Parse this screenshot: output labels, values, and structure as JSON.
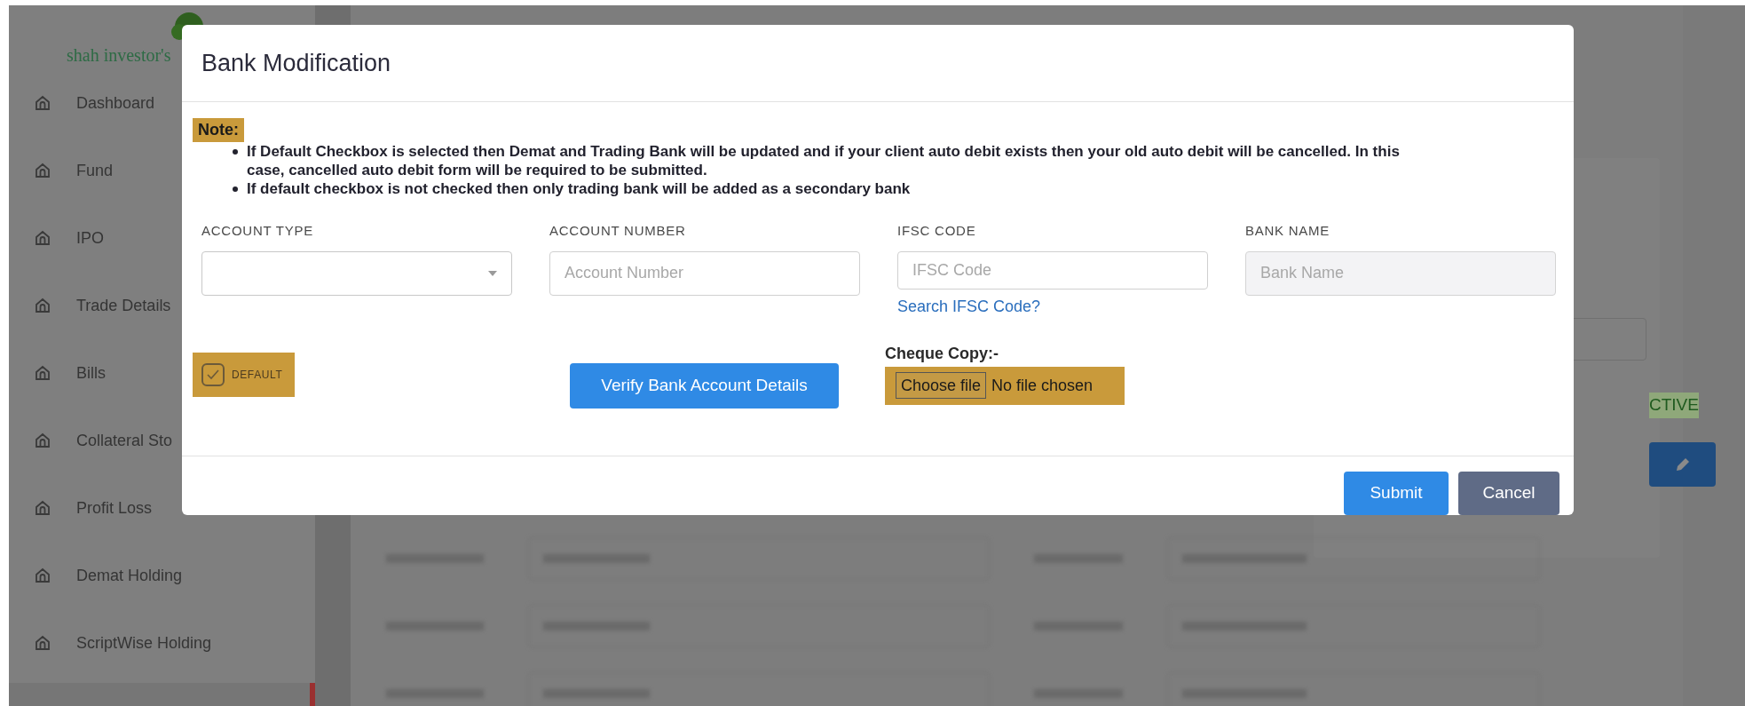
{
  "sidebar": {
    "logo_text": "shah investor's",
    "items": [
      {
        "label": "Dashboard"
      },
      {
        "label": "Fund"
      },
      {
        "label": "IPO"
      },
      {
        "label": "Trade Details"
      },
      {
        "label": "Bills"
      },
      {
        "label": "Collateral Sto"
      },
      {
        "label": "Profit Loss"
      },
      {
        "label": "Demat Holding"
      },
      {
        "label": "ScriptWise Holding"
      }
    ]
  },
  "background": {
    "status_text": "CTIVE"
  },
  "modal": {
    "title": "Bank Modification",
    "note": {
      "label": "Note:",
      "highlighted": true,
      "bullets": [
        "If Default Checkbox is selected then Demat and Trading Bank will be updated and if your client auto debit exists then your old auto debit will be cancelled. In this case, cancelled auto debit form will be required to be submitted.",
        "If default checkbox is not checked then only trading bank will be added as a secondary bank"
      ]
    },
    "fields": [
      {
        "kind": "select",
        "label": "ACCOUNT TYPE"
      },
      {
        "kind": "text",
        "label": "ACCOUNT NUMBER",
        "placeholder": "Account Number",
        "disabled": false
      },
      {
        "kind": "text",
        "label": "IFSC CODE",
        "placeholder": "IFSC Code",
        "disabled": false,
        "link": "Search IFSC Code?"
      },
      {
        "kind": "text",
        "label": "BANK NAME",
        "placeholder": "Bank Name",
        "disabled": true
      }
    ],
    "default_checkbox": {
      "label": "DEFAULT",
      "checked": true,
      "highlighted": true
    },
    "verify_button": "Verify Bank Account Details",
    "cheque": {
      "label": "Cheque Copy:-",
      "button": "Choose file",
      "status": "No file chosen",
      "highlighted": true
    },
    "buttons": [
      {
        "kind": "primary",
        "label": "Submit"
      },
      {
        "kind": "secondary",
        "label": "Cancel"
      }
    ]
  }
}
